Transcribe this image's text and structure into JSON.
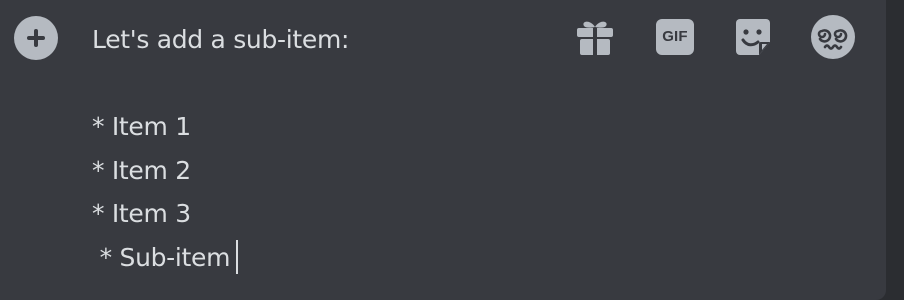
{
  "composer": {
    "lines": [
      "Let's add a sub-item:",
      "",
      "* Item 1",
      "* Item 2",
      "* Item 3",
      " * Sub-item"
    ]
  },
  "buttons": {
    "attach": {
      "icon": "plus-circle-icon"
    },
    "gift": {
      "icon": "gift-icon"
    },
    "gif": {
      "label": "GIF",
      "icon": "gif-icon"
    },
    "sticker": {
      "icon": "sticker-icon"
    },
    "emoji": {
      "icon": "dizzy-face-emoji-icon"
    }
  },
  "colors": {
    "background": "#383a40",
    "text": "#dbdee1",
    "icon": "#b5bac1"
  }
}
